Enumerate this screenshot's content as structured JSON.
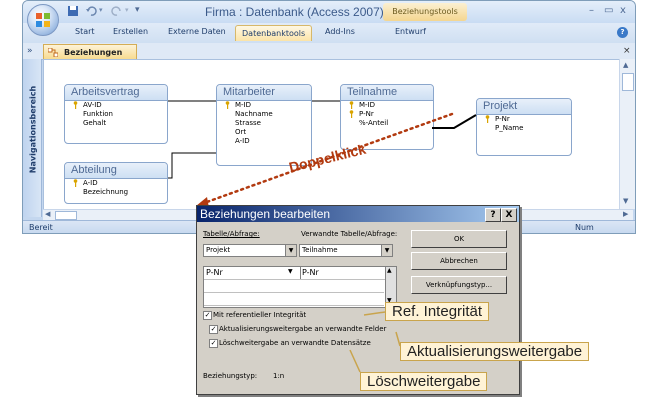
{
  "window": {
    "title": "Firma : Datenbank (Access 2007) - M...",
    "context_title": "Beziehungstools",
    "minimize": "–",
    "maximize": "▭",
    "close": "x"
  },
  "ribbon_tabs": [
    "Start",
    "Erstellen",
    "Externe Daten",
    "Datenbanktools",
    "Add-Ins",
    "Entwurf"
  ],
  "ribbon_active": "Datenbanktools",
  "nav": {
    "toggle": "»",
    "label": "Navigationsbereich"
  },
  "doc_tab": {
    "label": "Beziehungen",
    "close": "×"
  },
  "tables": {
    "arbeitsvertrag": {
      "title": "Arbeitsvertrag",
      "fields": [
        "AV-ID",
        "Funktion",
        "Gehalt"
      ]
    },
    "abteilung": {
      "title": "Abteilung",
      "fields": [
        "A-ID",
        "Bezeichnung"
      ]
    },
    "mitarbeiter": {
      "title": "Mitarbeiter",
      "fields": [
        "M-ID",
        "Nachname",
        "Strasse",
        "Ort",
        "A-ID"
      ]
    },
    "teilnahme": {
      "title": "Teilnahme",
      "fields": [
        "M-ID",
        "P-Nr",
        "%-Anteil"
      ]
    },
    "projekt": {
      "title": "Projekt",
      "fields": [
        "P-Nr",
        "P_Name"
      ]
    }
  },
  "annotation_doppelklick": "Doppelklick",
  "status": {
    "left": "Bereit",
    "right": "Num"
  },
  "dialog": {
    "title": "Beziehungen bearbeiten",
    "help": "?",
    "close": "X",
    "col1_label": "Tabelle/Abfrage:",
    "col2_label": "Verwandte Tabelle/Abfrage:",
    "table": "Projekt",
    "related_table": "Teilnahme",
    "field": "P-Nr",
    "related_field": "P-Nr",
    "ok": "OK",
    "cancel": "Abbrechen",
    "join_type": "Verknüpfungstyp...",
    "chk_integrity": "Mit referentieller Integrität",
    "chk_update": "Aktualisierungsweitergabe an verwandte Felder",
    "chk_delete": "Löschweitergabe an verwandte Datensätze",
    "rel_type_label": "Beziehungstyp:",
    "rel_type_value": "1:n"
  },
  "callouts": {
    "integrity": "Ref. Integrität",
    "update": "Aktualisierungsweitergabe",
    "delete": "Löschweitergabe"
  },
  "colors": {
    "accent": "#b23a10",
    "callout_bg": "#fff3d6",
    "ribbon": "#cfdff2",
    "dialog_title": "#08246b"
  }
}
